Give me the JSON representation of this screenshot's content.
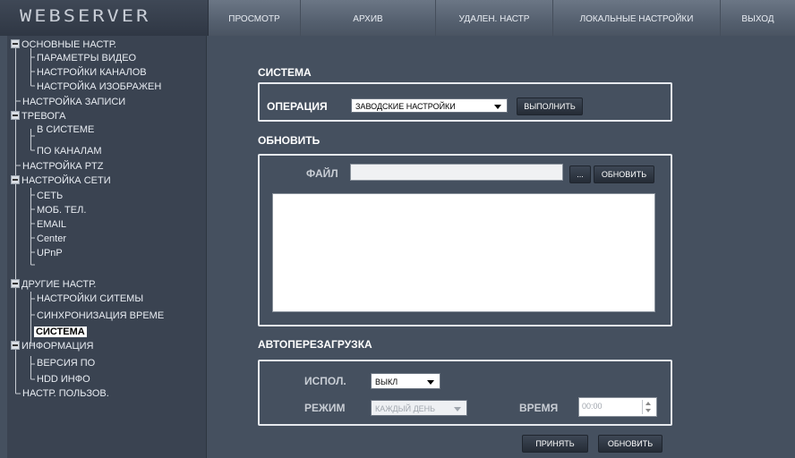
{
  "logo": "WEBSERVER",
  "nav": {
    "view": "ПРОСМОТР",
    "archive": "АРХИВ",
    "remote": "УДАЛЕН. НАСТР",
    "local": "ЛОКАЛЬНЫЕ НАСТРОЙКИ",
    "exit": "ВЫХОД"
  },
  "sidebar": {
    "basic": "ОСНОВНЫЕ НАСТР.",
    "video_params": "ПАРАМЕТРЫ ВИДЕО",
    "channel_settings": "НАСТРОЙКИ КАНАЛОВ",
    "image_settings": "НАСТРОЙКА ИЗОБРАЖЕН",
    "record_settings": "НАСТРОЙКА ЗАПИСИ",
    "alarm": "ТРЕВОГА",
    "in_system": "В СИСТЕМЕ",
    "by_channels": "ПО КАНАЛАМ",
    "ptz": "НАСТРОЙКА PTZ",
    "network": "НАСТРОЙКА СЕТИ",
    "net": "СЕТЬ",
    "mobile": "МОБ. ТЕЛ.",
    "email": "EMAIL",
    "center": "Center",
    "upnp": "UPnP",
    "other": "ДРУГИЕ НАСТР.",
    "system_settings": "НАСТРОЙКИ СИТЕМЫ",
    "time_sync": "СИНХРОНИЗАЦИЯ ВРЕМЕ",
    "system": "СИСТЕМА",
    "info": "ИНФОРМАЦИЯ",
    "version": "ВЕРСИЯ ПО",
    "hdd_info": "HDD ИНФО",
    "users": "НАСТР. ПОЛЬЗОВ."
  },
  "system": {
    "title": "СИСТЕМА",
    "operation_label": "ОПЕРАЦИЯ",
    "operation_value": "ЗАВОДСКИЕ НАСТРОЙКИ",
    "execute_button": "ВЫПОЛНИТЬ"
  },
  "update": {
    "title": "ОБНОВИТЬ",
    "file_label": "ФАЙЛ",
    "file_value": "",
    "browse_button": "...",
    "update_button": "ОБНОВИТЬ"
  },
  "autoreboot": {
    "title": "АВТОПЕРЕЗАГРУЗКА",
    "use_label": "ИСПОЛ.",
    "use_value": "ВЫКЛ",
    "mode_label": "РЕЖИМ",
    "mode_value": "КАЖДЫЙ ДЕНЬ",
    "time_label": "ВРЕМЯ",
    "time_value": "00:00"
  },
  "footer": {
    "apply_button": "ПРИНЯТЬ",
    "refresh_button": "ОБНОВИТЬ"
  }
}
